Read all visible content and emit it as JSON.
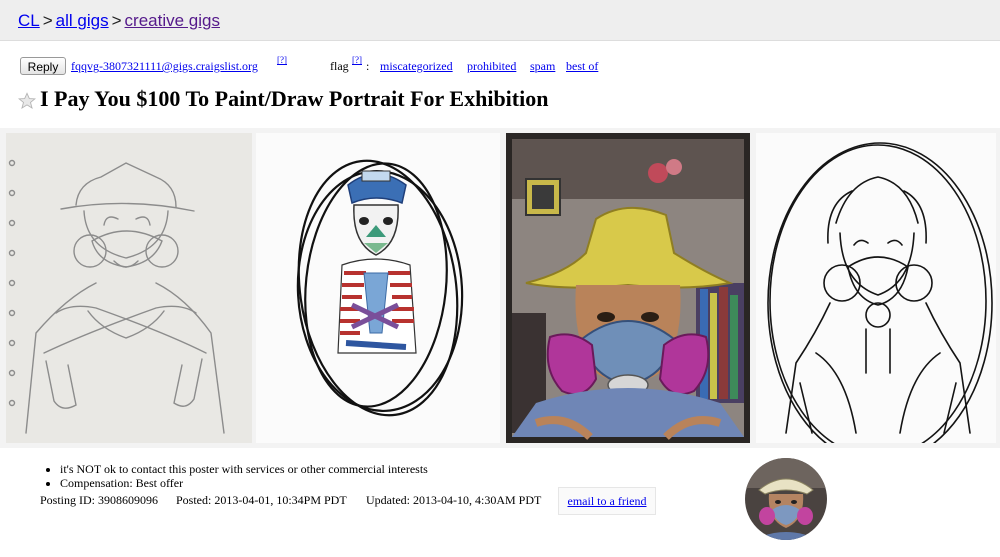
{
  "breadcrumb": {
    "home": "CL",
    "separator": ">",
    "category": "all gigs",
    "subcategory": "creative gigs"
  },
  "reply_bar": {
    "reply_label": "Reply",
    "email": "fqqvg-3807321111@gigs.craigslist.org",
    "help_mark": "[?]"
  },
  "flag": {
    "label": "flag",
    "help_mark": "[?]",
    "colon": ":",
    "options": [
      "miscategorized",
      "prohibited",
      "spam",
      "best of"
    ]
  },
  "post": {
    "title": "I Pay You $100 To Paint/Draw Portrait For Exhibition"
  },
  "images": [
    {
      "icon": "pencil-sketch-respirator-portrait"
    },
    {
      "icon": "marker-clown-portrait-in-oval"
    },
    {
      "icon": "colored-pencil-respirator-selfie"
    },
    {
      "icon": "ink-sketch-respirator-in-oval"
    }
  ],
  "attributes": [
    "it's NOT ok to contact this poster with services or other commercial interests",
    "Compensation: Best offer"
  ],
  "meta": {
    "posting_id": "Posting ID: 3908609096",
    "posted": "Posted: 2013-04-01, 10:34PM PDT",
    "updated": "Updated: 2013-04-10, 4:30AM PDT",
    "email_friend": "email to a friend"
  },
  "colors": {
    "link": "#0000ee",
    "visited_link": "#551a8b",
    "topbar": "#eeeeee",
    "respirator_blue": "#6f8fb8",
    "filter_magenta": "#b0369a",
    "hat_yellow": "#d8c94a"
  }
}
